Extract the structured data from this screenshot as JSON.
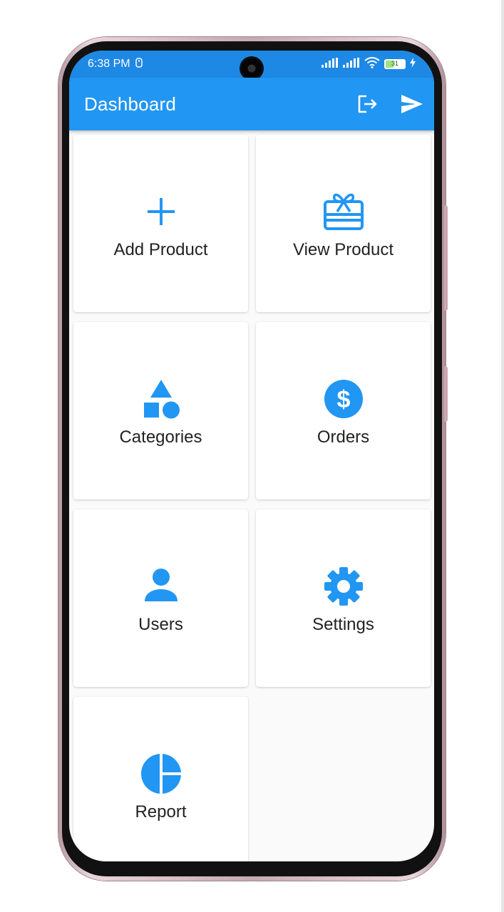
{
  "status_bar": {
    "time": "6:38 PM",
    "battery_level": "31"
  },
  "app_bar": {
    "title": "Dashboard",
    "actions": [
      {
        "icon": "logout-icon"
      },
      {
        "icon": "send-icon"
      }
    ]
  },
  "dashboard": {
    "items": [
      {
        "label": "Add Product",
        "icon": "add-icon"
      },
      {
        "label": "View Product",
        "icon": "gift-card-icon"
      },
      {
        "label": "Categories",
        "icon": "category-shapes-icon"
      },
      {
        "label": "Orders",
        "icon": "dollar-circle-icon"
      },
      {
        "label": "Users",
        "icon": "person-icon"
      },
      {
        "label": "Settings",
        "icon": "gear-icon"
      },
      {
        "label": "Report",
        "icon": "pie-chart-icon"
      }
    ]
  },
  "colors": {
    "primary": "#2196F3",
    "status_bar": "#1E88E5",
    "card_background": "#FFFFFF",
    "screen_background": "#FAFAFA",
    "text": "#222222"
  }
}
